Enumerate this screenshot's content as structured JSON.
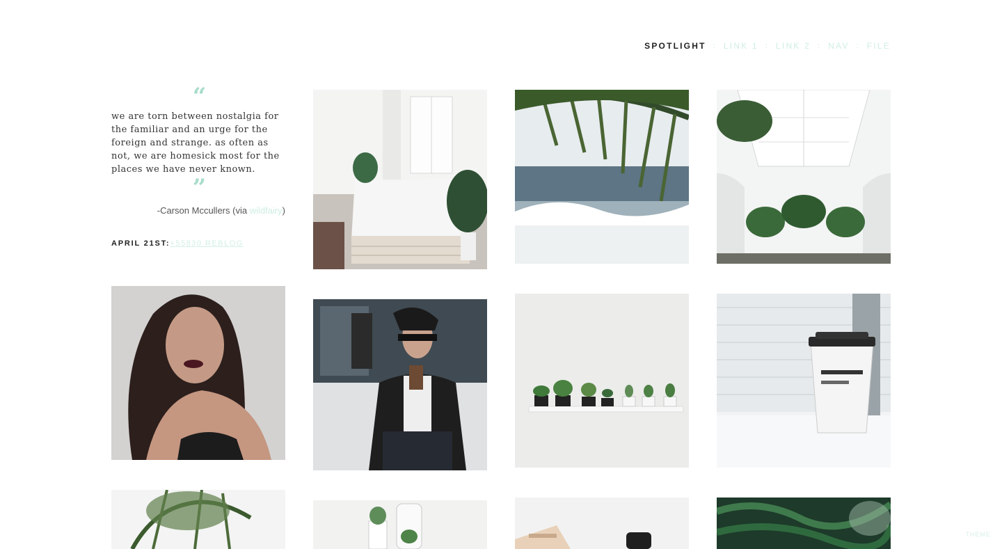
{
  "nav": {
    "title": "SPOTLIGHT",
    "separator": ":",
    "links": [
      "LINK 1",
      "LINK 2",
      "NAV",
      "FILE"
    ]
  },
  "quote": {
    "open_mark": "“",
    "close_mark": "”",
    "text": "we are torn between nostalgia for the familiar and an urge for the foreign and strange. as often as not, we are homesick most for the places we have never known.",
    "source_prefix": "-Carson Mccullers (via ",
    "source_link": "wildfairy",
    "source_suffix": ")"
  },
  "meta": {
    "date": "APRIL 21ST:",
    "notes": "+55830 REBLOG"
  },
  "posts": [
    {
      "subject": "bedroom with pallet bed and plants"
    },
    {
      "subject": "palm leaves over ocean waves"
    },
    {
      "subject": "white atrium with palm trees"
    },
    {
      "subject": "portrait with dark lipstick"
    },
    {
      "subject": "woman in sunglasses drinking iced coffee"
    },
    {
      "subject": "succulents on white shelf"
    },
    {
      "subject": "coffee cup on window sill"
    },
    {
      "subject": "palm fronds"
    },
    {
      "subject": "cactus and candle"
    },
    {
      "subject": "desk with notebook and phone"
    },
    {
      "subject": "dense tropical palms"
    }
  ],
  "footer": {
    "theme_credit": "THEME"
  },
  "colors": {
    "accent": "#a8dccb",
    "link": "#cfeee4",
    "text": "#333333"
  }
}
